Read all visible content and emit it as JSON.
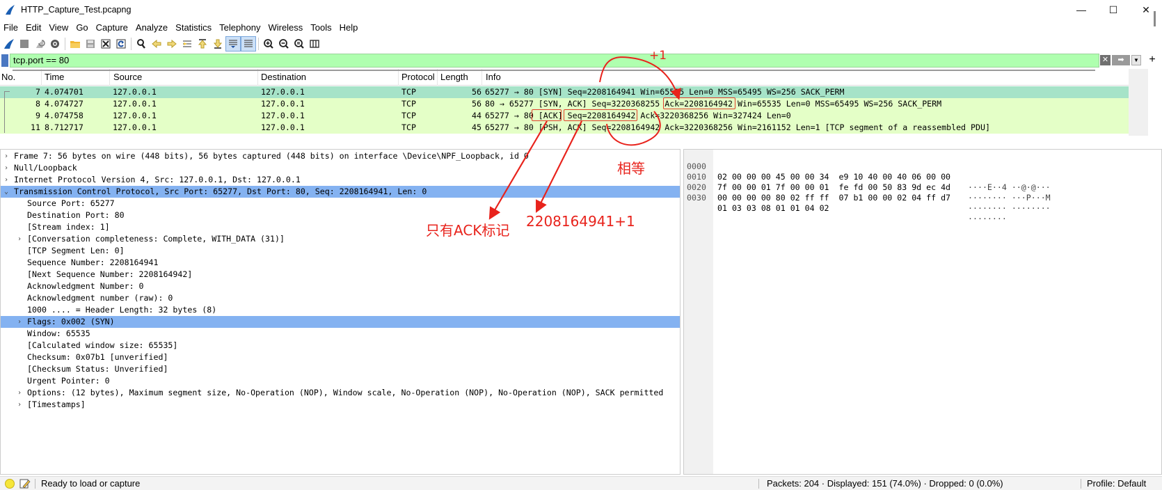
{
  "window": {
    "title": "HTTP_Capture_Test.pcapng",
    "min_glyph": "—",
    "max_glyph": "☐",
    "close_glyph": "✕"
  },
  "menu": [
    "File",
    "Edit",
    "View",
    "Go",
    "Capture",
    "Analyze",
    "Statistics",
    "Telephony",
    "Wireless",
    "Tools",
    "Help"
  ],
  "toolbar_icons": [
    "shark-fin-start-icon",
    "stop-icon",
    "restart-icon",
    "options-gear-icon",
    "open-folder-icon",
    "save-icon",
    "close-file-icon",
    "reload-icon",
    "find-icon",
    "back-icon",
    "forward-icon",
    "go-to-icon",
    "first-packet-icon",
    "last-packet-icon",
    "autoscroll-icon",
    "colorize-icon",
    "zoom-in-icon",
    "zoom-out-icon",
    "zoom-normal-icon",
    "resize-columns-icon"
  ],
  "filter": {
    "value": "tcp.port == 80",
    "clear_glyph": "✕",
    "apply_glyph": "➡",
    "dropdown_glyph": "▼",
    "add_glyph": "+"
  },
  "packet_list": {
    "columns": [
      "No.",
      "Time",
      "Source",
      "Destination",
      "Protocol",
      "Length",
      "Info"
    ],
    "rows": [
      {
        "no": "7",
        "time": "4.074701",
        "src": "127.0.0.1",
        "dst": "127.0.0.1",
        "proto": "TCP",
        "len": "56",
        "info": "65277 → 80 [SYN] Seq=2208164941 Win=65535 Len=0 MSS=65495 WS=256 SACK_PERM",
        "selected": true
      },
      {
        "no": "8",
        "time": "4.074727",
        "src": "127.0.0.1",
        "dst": "127.0.0.1",
        "proto": "TCP",
        "len": "56",
        "info": "80 → 65277 [SYN, ACK] Seq=3220368255 Ack=2208164942 Win=65535 Len=0 MSS=65495 WS=256 SACK_PERM",
        "selected": false
      },
      {
        "no": "9",
        "time": "4.074758",
        "src": "127.0.0.1",
        "dst": "127.0.0.1",
        "proto": "TCP",
        "len": "44",
        "info": "65277 → 80 [ACK] Seq=2208164942 Ack=3220368256 Win=327424 Len=0",
        "selected": false
      },
      {
        "no": "11",
        "time": "8.712717",
        "src": "127.0.0.1",
        "dst": "127.0.0.1",
        "proto": "TCP",
        "len": "45",
        "info": "65277 → 80 [PSH, ACK] Seq=2208164942 Ack=3220368256 Win=2161152 Len=1 [TCP segment of a reassembled PDU]",
        "selected": false
      }
    ]
  },
  "details": [
    {
      "indent": 0,
      "arrow": "›",
      "text": "Frame 7: 56 bytes on wire (448 bits), 56 bytes captured (448 bits) on interface \\Device\\NPF_Loopback, id 0",
      "hl": false
    },
    {
      "indent": 0,
      "arrow": "›",
      "text": "Null/Loopback",
      "hl": false
    },
    {
      "indent": 0,
      "arrow": "›",
      "text": "Internet Protocol Version 4, Src: 127.0.0.1, Dst: 127.0.0.1",
      "hl": false
    },
    {
      "indent": 0,
      "arrow": "⌄",
      "text": "Transmission Control Protocol, Src Port: 65277, Dst Port: 80, Seq: 2208164941, Len: 0",
      "hl": true
    },
    {
      "indent": 1,
      "arrow": "",
      "text": "Source Port: 65277",
      "hl": false
    },
    {
      "indent": 1,
      "arrow": "",
      "text": "Destination Port: 80",
      "hl": false
    },
    {
      "indent": 1,
      "arrow": "",
      "text": "[Stream index: 1]",
      "hl": false
    },
    {
      "indent": 1,
      "arrow": "›",
      "text": "[Conversation completeness: Complete, WITH_DATA (31)]",
      "hl": false
    },
    {
      "indent": 1,
      "arrow": "",
      "text": "[TCP Segment Len: 0]",
      "hl": false
    },
    {
      "indent": 1,
      "arrow": "",
      "text": "Sequence Number: 2208164941",
      "hl": false
    },
    {
      "indent": 1,
      "arrow": "",
      "text": "[Next Sequence Number: 2208164942]",
      "hl": false
    },
    {
      "indent": 1,
      "arrow": "",
      "text": "Acknowledgment Number: 0",
      "hl": false
    },
    {
      "indent": 1,
      "arrow": "",
      "text": "Acknowledgment number (raw): 0",
      "hl": false
    },
    {
      "indent": 1,
      "arrow": "",
      "text": "1000 .... = Header Length: 32 bytes (8)",
      "hl": false
    },
    {
      "indent": 1,
      "arrow": "›",
      "text": "Flags: 0x002 (SYN)",
      "hl": true
    },
    {
      "indent": 1,
      "arrow": "",
      "text": "Window: 65535",
      "hl": false
    },
    {
      "indent": 1,
      "arrow": "",
      "text": "[Calculated window size: 65535]",
      "hl": false
    },
    {
      "indent": 1,
      "arrow": "",
      "text": "Checksum: 0x07b1 [unverified]",
      "hl": false
    },
    {
      "indent": 1,
      "arrow": "",
      "text": "[Checksum Status: Unverified]",
      "hl": false
    },
    {
      "indent": 1,
      "arrow": "",
      "text": "Urgent Pointer: 0",
      "hl": false
    },
    {
      "indent": 1,
      "arrow": "›",
      "text": "Options: (12 bytes), Maximum segment size, No-Operation (NOP), Window scale, No-Operation (NOP), No-Operation (NOP), SACK permitted",
      "hl": false
    },
    {
      "indent": 1,
      "arrow": "›",
      "text": "[Timestamps]",
      "hl": false
    }
  ],
  "bytes": [
    {
      "offset": "0000",
      "hex": "02 00 00 00 45 00 00 34  e9 10 40 00 40 06 00 00",
      "ascii": "····E··4 ··@·@···"
    },
    {
      "offset": "0010",
      "hex": "7f 00 00 01 7f 00 00 01  fe fd 00 50 83 9d ec 4d",
      "ascii": "········ ···P···M"
    },
    {
      "offset": "0020",
      "hex": "00 00 00 00 80 02 ff ff  07 b1 00 00 02 04 ff d7",
      "ascii": "········ ········"
    },
    {
      "offset": "0030",
      "hex": "01 03 03 08 01 01 04 02",
      "ascii": "········"
    }
  ],
  "status": {
    "ready": "Ready to load or capture",
    "counts": "Packets: 204 · Displayed: 151 (74.0%) · Dropped: 0 (0.0%)",
    "profile": "Profile: Default"
  },
  "annotations": {
    "plus_one": "+1",
    "equal": "相等",
    "only_ack": "只有ACK标记",
    "seq_plus": "2208164941+1",
    "color": "#e8231c"
  }
}
